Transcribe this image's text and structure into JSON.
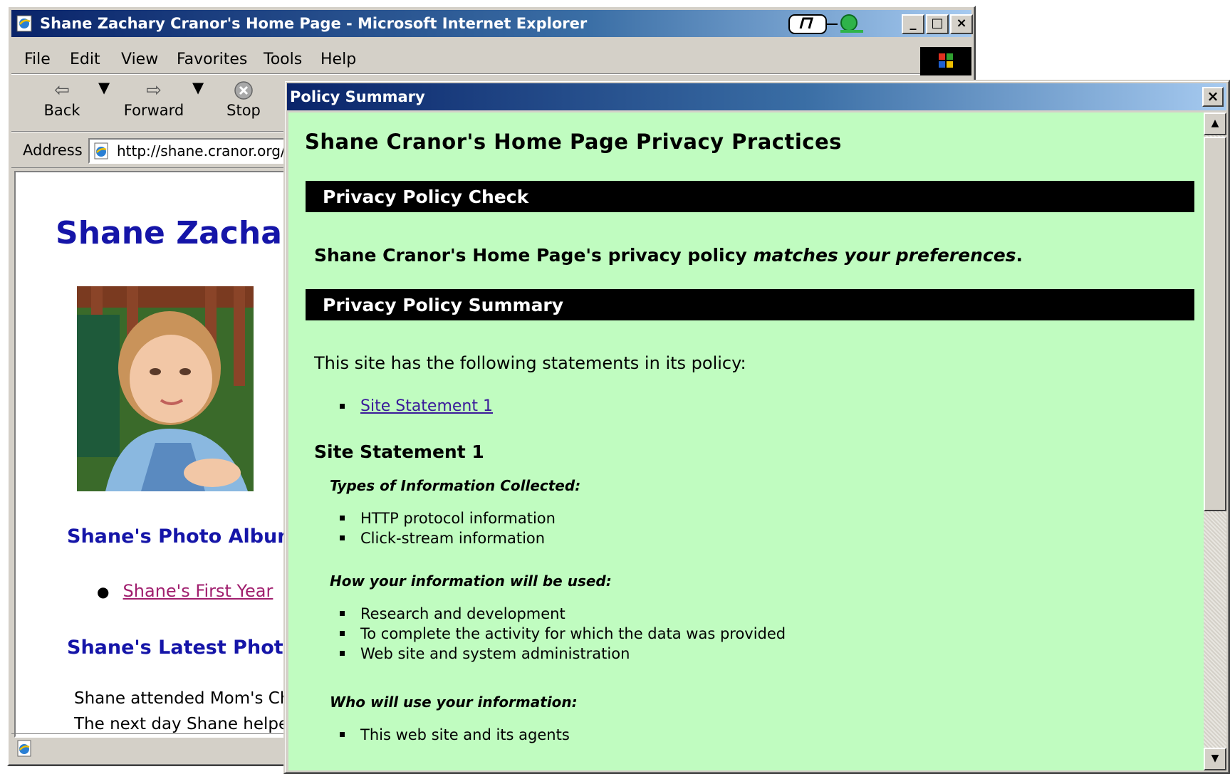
{
  "browser": {
    "title": "Shane Zachary Cranor's Home Page - Microsoft Internet Explorer",
    "window_buttons": {
      "minimize": "_",
      "maximize": "□",
      "close": "×"
    },
    "menu": [
      "File",
      "Edit",
      "View",
      "Favorites",
      "Tools",
      "Help"
    ],
    "toolbar": {
      "back": "Back",
      "forward": "Forward",
      "stop": "Stop"
    },
    "address_label": "Address",
    "address_value": "http://shane.cranor.org/"
  },
  "page": {
    "heading": "Shane Zachary Cranor's Home Page",
    "photo_album_heading": "Shane's Photo Album",
    "album_link": "Shane's First Year",
    "latest_heading": "Shane's Latest Photos",
    "para_line_1": "Shane attended Mom's Chr",
    "para_line_2": "The next day Shane helpe"
  },
  "policy": {
    "window_title": "Policy Summary",
    "close": "×",
    "heading": "Shane Cranor's Home Page Privacy Practices",
    "check_bar": "Privacy Policy Check",
    "match_prefix": "Shane Cranor's Home Page's privacy policy ",
    "match_emph": "matches your preferences",
    "match_suffix": ".",
    "summary_bar": "Privacy Policy Summary",
    "intro": "This site has the following statements in its policy:",
    "statement_link": "Site Statement 1",
    "statement_heading": "Site Statement 1",
    "types_heading": "Types of Information Collected:",
    "types": [
      "HTTP protocol information",
      "Click-stream information"
    ],
    "use_heading": "How your information will be used:",
    "uses": [
      "Research and development",
      "To complete the activity for which the data was provided",
      "Web site and system administration"
    ],
    "who_heading": "Who will use your information:",
    "who": [
      "This web site and its agents"
    ]
  },
  "colors": {
    "titlebar": "#0a246a",
    "policy_bg": "#c0fcc0",
    "page_heading": "#1515a8",
    "visited_link": "#a01e6e"
  }
}
